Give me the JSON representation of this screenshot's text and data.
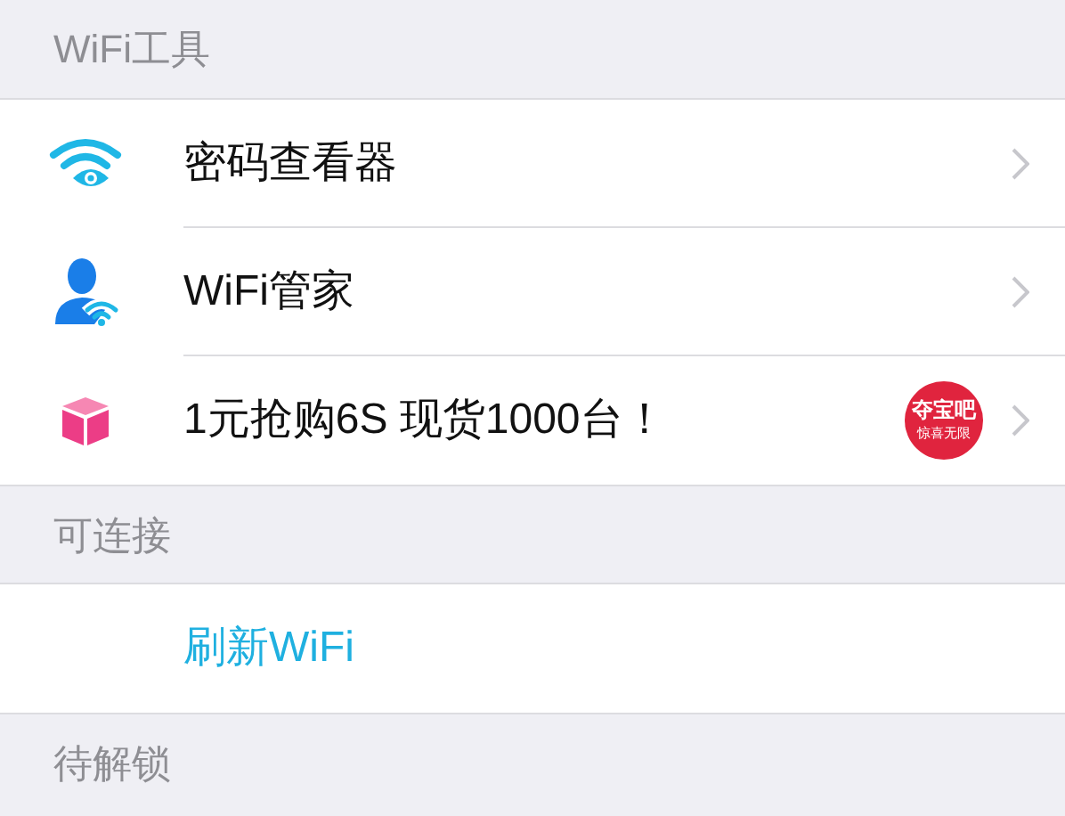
{
  "sections": [
    {
      "title": "WiFi工具",
      "items": [
        {
          "kind": "nav",
          "label": "密码查看器"
        },
        {
          "kind": "nav",
          "label": "WiFi管家"
        },
        {
          "kind": "nav",
          "label": "1元抢购6S 现货1000台！",
          "badge": {
            "title": "夺宝吧",
            "subtitle": "惊喜无限"
          }
        }
      ]
    },
    {
      "title": "可连接",
      "items": [
        {
          "kind": "action",
          "label": "刷新WiFi"
        }
      ]
    },
    {
      "title": "待解锁"
    }
  ]
}
